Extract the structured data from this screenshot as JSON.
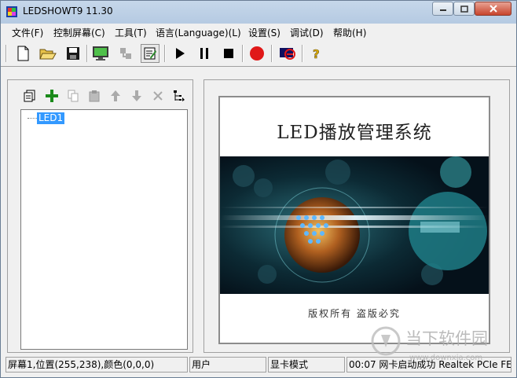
{
  "window": {
    "title": "LEDSHOWT9 11.30"
  },
  "menu": [
    "文件(F)",
    "控制屏幕(C)",
    "工具(T)",
    "语言(Language)(L)",
    "设置(S)",
    "调试(D)",
    "帮助(H)"
  ],
  "toolbar_icons": [
    "new-file-icon",
    "open-folder-icon",
    "save-icon",
    "monitor-icon",
    "connect-icon",
    "edit-program-icon",
    "play-icon",
    "pause-icon",
    "stop-icon",
    "record-icon",
    "screen-off-icon",
    "help-icon"
  ],
  "tree": {
    "node": "LED1"
  },
  "splash": {
    "title": "LED播放管理系统",
    "footer": "版权所有 盗版必究"
  },
  "status": {
    "position": "屏幕1,位置(255,238),颜色(0,0,0)",
    "user": "用户",
    "mode": "显卡模式",
    "message": "00:07 网卡启动成功 Realtek PCIe FE F"
  },
  "watermark": {
    "cn": "当下软件园",
    "url": "www.downxia.com"
  }
}
